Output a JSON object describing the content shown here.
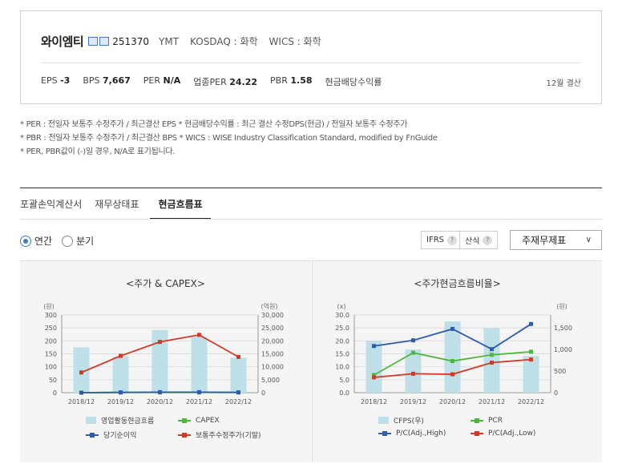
{
  "company": {
    "name": "와이엠티",
    "code": "251370",
    "eng": "YMT",
    "market": "KOSDAQ : 화학",
    "wics": "WICS : 화학",
    "settlement": "12월 결산"
  },
  "metrics": [
    {
      "label": "EPS",
      "value": "-3"
    },
    {
      "label": "BPS",
      "value": "7,667"
    },
    {
      "label": "PER",
      "value": "N/A"
    },
    {
      "label": "업종PER",
      "value": "24.22"
    },
    {
      "label": "PBR",
      "value": "1.58"
    },
    {
      "label": "현금배당수익률",
      "value": ""
    }
  ],
  "notes": [
    "* PER : 전일자 보통주 수정주가 / 최근결산 EPS * 현금배당수익률 : 최근 결산 수정DPS(현금) / 전일자 보통주 수정주가",
    "* PBR : 전일자 보통주 수정주가 / 최근결산 BPS * WICS : WISE Industry Classification Standard, modified by FnGuide",
    "* PER, PBR값이 (-)일 경우, N/A로 표기됩니다."
  ],
  "tabs": [
    "포괄손익계산서",
    "재무상태표",
    "현금흐름표"
  ],
  "period": {
    "annual": "연간",
    "quarter": "분기"
  },
  "options": {
    "ifrs": "IFRS",
    "calc": "산식",
    "help": "?",
    "select": "주재무제표"
  },
  "chart_data": [
    {
      "type": "bar",
      "title": "<주가 & CAPEX>",
      "left_unit": "(원)",
      "right_unit": "(억원)",
      "categories": [
        "2018/12",
        "2019/12",
        "2020/12",
        "2021/12",
        "2022/12"
      ],
      "left_ticks": [
        "300",
        "250",
        "200",
        "150",
        "100",
        "50",
        "0"
      ],
      "right_ticks": [
        "30,000",
        "25,000",
        "20,000",
        "15,000",
        "10,000",
        "5,000",
        "0"
      ],
      "ylim_left": [
        0,
        300
      ],
      "ylim_right": [
        0,
        30000
      ],
      "series": [
        {
          "name": "영업활동현금흐름",
          "kind": "bar",
          "axis": "left",
          "color": "#bfe0e8",
          "values": [
            175,
            140,
            242,
            215,
            135
          ]
        },
        {
          "name": "CAPEX",
          "kind": "line",
          "axis": "left",
          "color": "#4fb63d",
          "values": [
            0,
            1,
            1,
            1,
            1
          ]
        },
        {
          "name": "당기순이익",
          "kind": "line",
          "axis": "left",
          "color": "#2f5bab",
          "values": [
            0,
            1,
            2,
            2,
            1
          ]
        },
        {
          "name": "보통주수정주가(기말)",
          "kind": "line",
          "axis": "right",
          "color": "#d23a26",
          "values": [
            7800,
            14200,
            19600,
            22300,
            13800
          ]
        }
      ]
    },
    {
      "type": "bar",
      "title": "<주가현금흐름비율>",
      "left_unit": "(x)",
      "right_unit": "(원)",
      "categories": [
        "2018/12",
        "2019/12",
        "2020/12",
        "2021/12",
        "2022/12"
      ],
      "left_ticks": [
        "30.0",
        "25.0",
        "20.0",
        "15.0",
        "10.0",
        "5.0",
        "0.0"
      ],
      "right_ticks": [
        "1,500",
        "1,000",
        "500",
        "0"
      ],
      "ylim_left": [
        0,
        30
      ],
      "ylim_right": [
        0,
        1800
      ],
      "right_tick_values": [
        1500,
        1000,
        500,
        0
      ],
      "series": [
        {
          "name": "CFPS(우)",
          "kind": "bar",
          "axis": "right",
          "color": "#bfe0e8",
          "values": [
            1200,
            1000,
            1650,
            1500,
            850
          ]
        },
        {
          "name": "PCR",
          "kind": "line",
          "axis": "left",
          "color": "#4fb63d",
          "values": [
            6.8,
            15.4,
            12.2,
            14.6,
            15.8
          ]
        },
        {
          "name": "P/C(Adj.,High)",
          "kind": "line",
          "axis": "left",
          "color": "#2f5bab",
          "values": [
            18.0,
            20.2,
            24.6,
            16.8,
            26.5
          ]
        },
        {
          "name": "P/C(Adj.,Low)",
          "kind": "line",
          "axis": "left",
          "color": "#d23a26",
          "values": [
            5.9,
            7.3,
            7.1,
            11.6,
            12.8
          ]
        }
      ]
    }
  ]
}
